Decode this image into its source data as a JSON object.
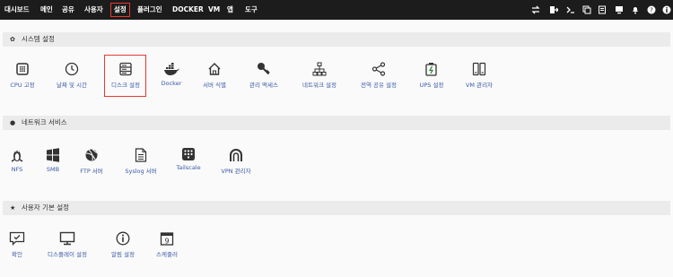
{
  "nav": {
    "items": [
      "대시보드",
      "메인",
      "공유",
      "사용자",
      "설정",
      "플러그인",
      "DOCKER",
      "VM",
      "앱",
      "도구"
    ],
    "active": "설정"
  },
  "top_icons": [
    "switch-icon",
    "logout-icon",
    "terminal-icon",
    "copy-icon",
    "notes-icon",
    "monitor-icon",
    "bell-icon",
    "help-icon",
    "info-icon"
  ],
  "sections": [
    {
      "title": "시스템 설정",
      "icon": "gear-icon",
      "items": [
        {
          "label": "CPU 고정",
          "icon": "cpu-icon"
        },
        {
          "label": "날짜 및 시간",
          "icon": "clock-icon"
        },
        {
          "label": "디스크 설정",
          "icon": "disk-icon"
        },
        {
          "label": "Docker",
          "icon": "docker-icon"
        },
        {
          "label": "서버 식별",
          "icon": "home-icon"
        },
        {
          "label": "관리 액세스",
          "icon": "key-icon"
        },
        {
          "label": "네트워크 설정",
          "icon": "network-icon"
        },
        {
          "label": "전역 공유 설정",
          "icon": "share-icon"
        },
        {
          "label": "UPS 설정",
          "icon": "battery-icon"
        },
        {
          "label": "VM 관리자",
          "icon": "vm-icon"
        }
      ]
    },
    {
      "title": "네트워크 서비스",
      "icon": "globe-icon",
      "items": [
        {
          "label": "NFS",
          "icon": "linux-icon"
        },
        {
          "label": "SMB",
          "icon": "windows-icon"
        },
        {
          "label": "FTP 서버",
          "icon": "ftp-icon"
        },
        {
          "label": "Syslog 서버",
          "icon": "document-icon"
        },
        {
          "label": "Tailscale",
          "icon": "tailscale-icon"
        },
        {
          "label": "VPN 관리자",
          "icon": "vpn-icon"
        }
      ]
    },
    {
      "title": "사용자 기본 설정",
      "icon": "star-icon",
      "items": [
        {
          "label": "확인",
          "icon": "confirm-icon"
        },
        {
          "label": "디스플레이 설정",
          "icon": "display-icon"
        },
        {
          "label": "알림 설정",
          "icon": "info-circle-icon"
        },
        {
          "label": "스케줄러",
          "icon": "calendar-icon"
        }
      ]
    }
  ],
  "calendar_day": "9",
  "colors": {
    "topbar": "#1c1c1c",
    "label": "#3a5aa5",
    "highlight": "#e53935",
    "section_bg": "#ebebeb"
  }
}
